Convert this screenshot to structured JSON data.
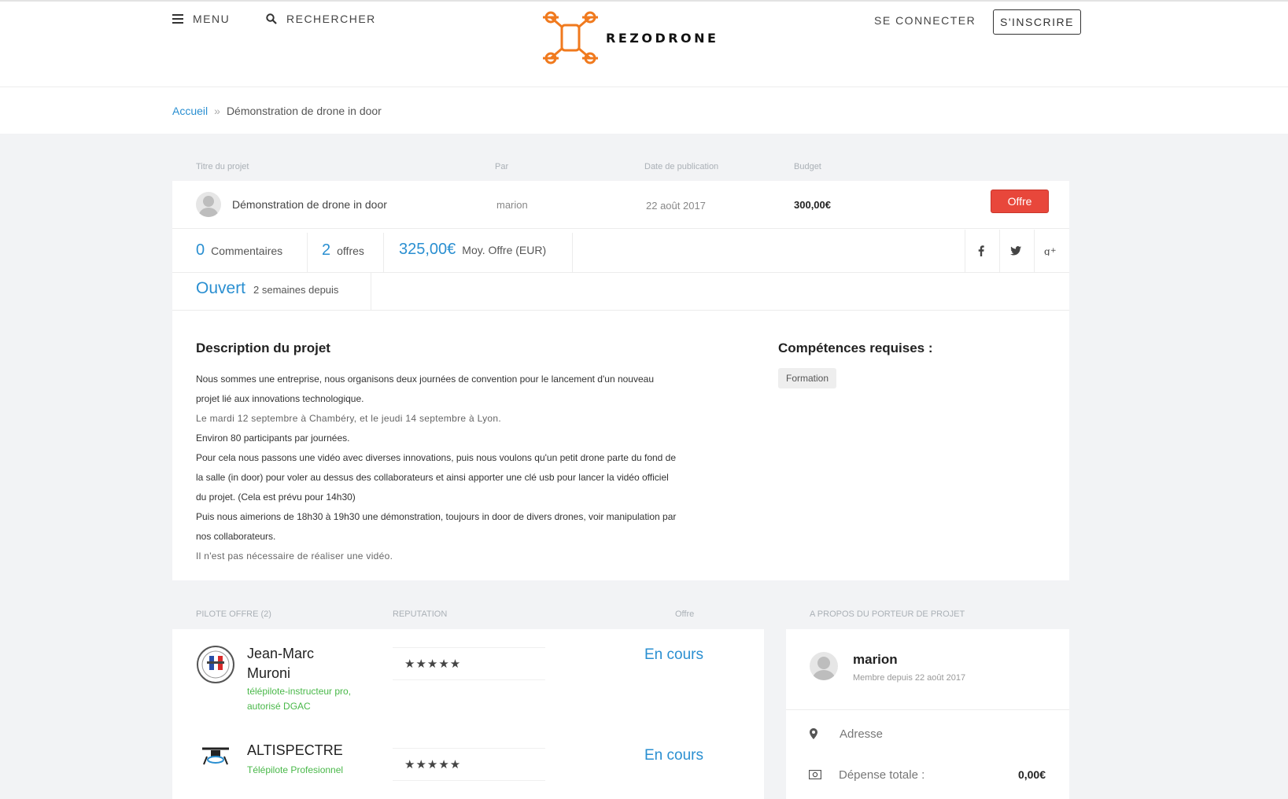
{
  "header": {
    "menu_label": "MENU",
    "search_label": "RECHERCHER",
    "logo_text": "REZODRONE",
    "login_label": "SE CONNECTER",
    "signup_label": "S'INSCRIRE"
  },
  "breadcrumb": {
    "home": "Accueil",
    "separator": "»",
    "current": "Démonstration de drone in door"
  },
  "project_table": {
    "col_title": "Titre du projet",
    "col_by": "Par",
    "col_date": "Date de publication",
    "col_budget": "Budget",
    "title": "Démonstration de drone in door",
    "by": "marion",
    "date": "22 août 2017",
    "budget": "300,00€",
    "offer_button": "Offre"
  },
  "stats": {
    "comments_count": "0",
    "comments_label": "Commentaires",
    "offers_count": "2",
    "offers_label": "offres",
    "avg_value": "325,00€",
    "avg_label": "Moy. Offre (EUR)",
    "status": "Ouvert",
    "status_since": "2 semaines depuis"
  },
  "social": [
    "facebook-icon",
    "twitter-icon",
    "google-plus-icon"
  ],
  "description": {
    "title": "Description du projet",
    "lines": [
      "Nous sommes une entreprise, nous organisons deux journées de convention pour le lancement d'un nouveau",
      "projet lié aux innovations technologique.",
      "Le mardi 12 septembre à Chambéry, et le jeudi 14 septembre à Lyon.",
      "Environ 80 participants par journées.",
      "Pour cela nous passons une vidéo avec diverses innovations, puis nous voulons qu'un petit drone parte du fond de",
      "la salle (in door) pour voler au dessus des collaborateurs et ainsi apporter une clé usb pour lancer la vidéo officiel",
      "du projet. (Cela est prévu pour 14h30)",
      "Puis nous aimerions de 18h30 à 19h30 une démonstration, toujours in door de divers drones, voir manipulation par",
      "nos collaborateurs.",
      "Il n'est pas nécessaire de réaliser une vidéo."
    ]
  },
  "skills": {
    "title": "Compétences requises :",
    "items": [
      "Formation"
    ]
  },
  "pilots_table": {
    "col_pilot": "PILOTE OFFRE (2)",
    "col_reputation": "REPUTATION",
    "col_offer": "Offre",
    "col_about": "A PROPOS DU PORTEUR DE PROJET",
    "pilots": [
      {
        "name_line1": "Jean-Marc",
        "name_line2": "Muroni",
        "sub_line1": "télépilote-instructeur pro,",
        "sub_line2": "autorisé DGAC",
        "stars": "★★★★★",
        "status": "En cours"
      },
      {
        "name_line1": "ALTISPECTRE",
        "sub_line1": "Télépilote Profesionnel",
        "stars": "★★★★★",
        "status": "En cours"
      }
    ]
  },
  "about": {
    "name": "marion",
    "member_since": "Membre depuis 22 août 2017",
    "address_label": "Adresse",
    "spent_label": "Dépense totale :",
    "spent_value": "0,00€"
  },
  "colors": {
    "accent_blue": "#2a8fd1",
    "offer_red": "#e8473b",
    "logo_orange": "#f07a1e",
    "pilot_green": "#49b849"
  }
}
